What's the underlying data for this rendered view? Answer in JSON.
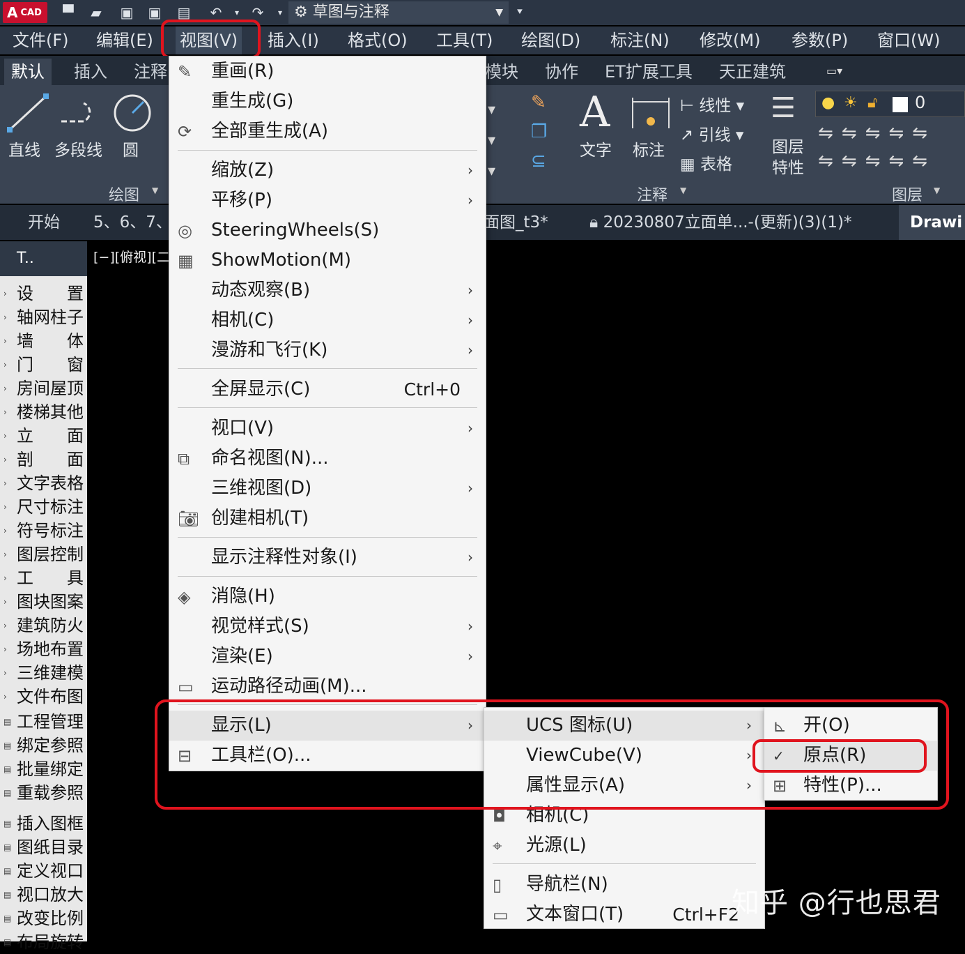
{
  "titlebar": {
    "logo_letter": "A",
    "logo_text": "CAD",
    "workspace": "草图与注释"
  },
  "menubar": [
    "文件(F)",
    "编辑(E)",
    "视图(V)",
    "插入(I)",
    "格式(O)",
    "工具(T)",
    "绘图(D)",
    "标注(N)",
    "修改(M)",
    "参数(P)",
    "窗口(W)"
  ],
  "ribbon_tabs": [
    "默认",
    "插入",
    "注释",
    "模块",
    "协作",
    "ET扩展工具",
    "天正建筑"
  ],
  "ribbon": {
    "draw_tools": [
      "直线",
      "多段线",
      "圆"
    ],
    "draw_panel": "绘图",
    "annot_text": "文字",
    "annot_dim": "标注",
    "annot_small": [
      "线性",
      "引线",
      "表格"
    ],
    "annot_panel": "注释",
    "layer_props": "图层\n特性",
    "layer_props_l1": "图层",
    "layer_props_l2": "特性",
    "layer_current": "0",
    "layer_panel": "图层"
  },
  "doc_tabs": [
    "开始",
    "5、6、7、",
    "面图_t3*",
    "20230807立面单...-(更新)(3)(1)*",
    "Drawi"
  ],
  "palette": {
    "header": "T..",
    "items": [
      "设　　置",
      "轴网柱子",
      "墙　　体",
      "门　　窗",
      "房间屋顶",
      "楼梯其他",
      "立　　面",
      "剖　　面",
      "文字表格",
      "尺寸标注",
      "符号标注",
      "图层控制",
      "工　　具",
      "图块图案",
      "建筑防火",
      "场地布置",
      "三维建模",
      "文件布图",
      "工程管理",
      "绑定参照",
      "批量绑定",
      "重载参照",
      "插入图框",
      "图纸目录",
      "定义视口",
      "视口放大",
      "改变比例",
      "布局旋转"
    ]
  },
  "viewport_label": "[−][俯视][二",
  "view_menu": {
    "items": [
      {
        "label": "重画(R)",
        "icon": "redraw-icon"
      },
      {
        "label": "重生成(G)"
      },
      {
        "label": "全部重生成(A)",
        "icon": "regen-all-icon"
      },
      {
        "label": "缩放(Z)",
        "sub": true
      },
      {
        "label": "平移(P)",
        "sub": true
      },
      {
        "label": "SteeringWheels(S)",
        "icon": "steeringwheel-icon"
      },
      {
        "label": "ShowMotion(M)",
        "icon": "showmotion-icon"
      },
      {
        "label": "动态观察(B)",
        "sub": true
      },
      {
        "label": "相机(C)",
        "sub": true
      },
      {
        "label": "漫游和飞行(K)",
        "sub": true
      },
      {
        "label": "全屏显示(C)",
        "shortcut": "Ctrl+0"
      },
      {
        "label": "视口(V)",
        "sub": true
      },
      {
        "label": "命名视图(N)...",
        "icon": "named-view-icon"
      },
      {
        "label": "三维视图(D)",
        "sub": true
      },
      {
        "label": "创建相机(T)",
        "icon": "camera-icon"
      },
      {
        "label": "显示注释性对象(I)",
        "sub": true
      },
      {
        "label": "消隐(H)",
        "icon": "hide-icon"
      },
      {
        "label": "视觉样式(S)",
        "sub": true
      },
      {
        "label": "渲染(E)",
        "sub": true
      },
      {
        "label": "运动路径动画(M)...",
        "icon": "motion-path-icon"
      },
      {
        "label": "显示(L)",
        "sub": true
      },
      {
        "label": "工具栏(O)...",
        "icon": "toolbar-icon"
      }
    ]
  },
  "display_menu": {
    "items": [
      {
        "label": "UCS 图标(U)",
        "sub": true
      },
      {
        "label": "ViewCube(V)",
        "sub": true
      },
      {
        "label": "属性显示(A)",
        "sub": true
      },
      {
        "label": "相机(C)"
      },
      {
        "label": "光源(L)"
      },
      {
        "label": "导航栏(N)"
      },
      {
        "label": "文本窗口(T)",
        "shortcut": "Ctrl+F2"
      }
    ]
  },
  "ucs_menu": {
    "items": [
      {
        "label": "开(O)"
      },
      {
        "label": "原点(R)",
        "checked": true
      },
      {
        "label": "特性(P)..."
      }
    ]
  },
  "watermark": "知乎 @行也思君",
  "colors": {
    "accent_red": "#e0141e",
    "ribbon_bg": "#3a4453",
    "menu_bg": "#f5f5f5"
  }
}
